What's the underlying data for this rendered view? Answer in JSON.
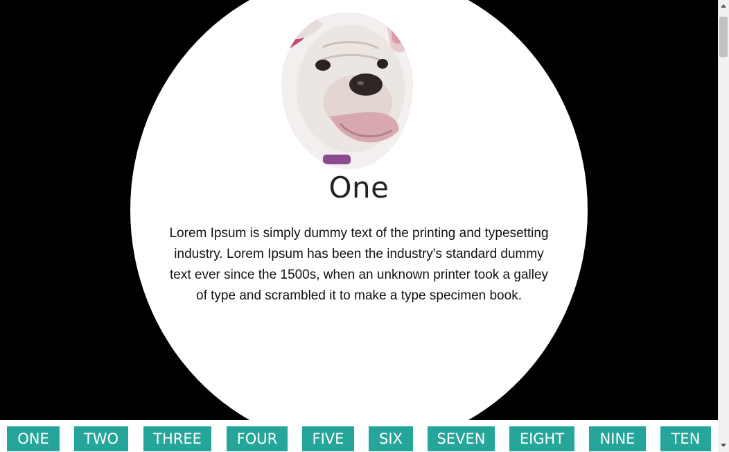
{
  "slide": {
    "title": "One",
    "description": "Lorem Ipsum is simply dummy text of the printing and typesetting industry. Lorem Ipsum has been the industry's standard dummy text ever since the 1500s, when an unknown printer took a galley of type and scrambled it to make a type specimen book.",
    "image_subject": "bulldog-photo"
  },
  "nav": {
    "buttons": [
      "ONE",
      "TWO",
      "THREE",
      "FOUR",
      "FIVE",
      "SIX",
      "SEVEN",
      "EIGHT",
      "NINE",
      "TEN"
    ]
  },
  "colors": {
    "button_bg": "#26a69a",
    "button_text": "#ffffff",
    "background": "#000000",
    "spotlight": "#ffffff"
  }
}
